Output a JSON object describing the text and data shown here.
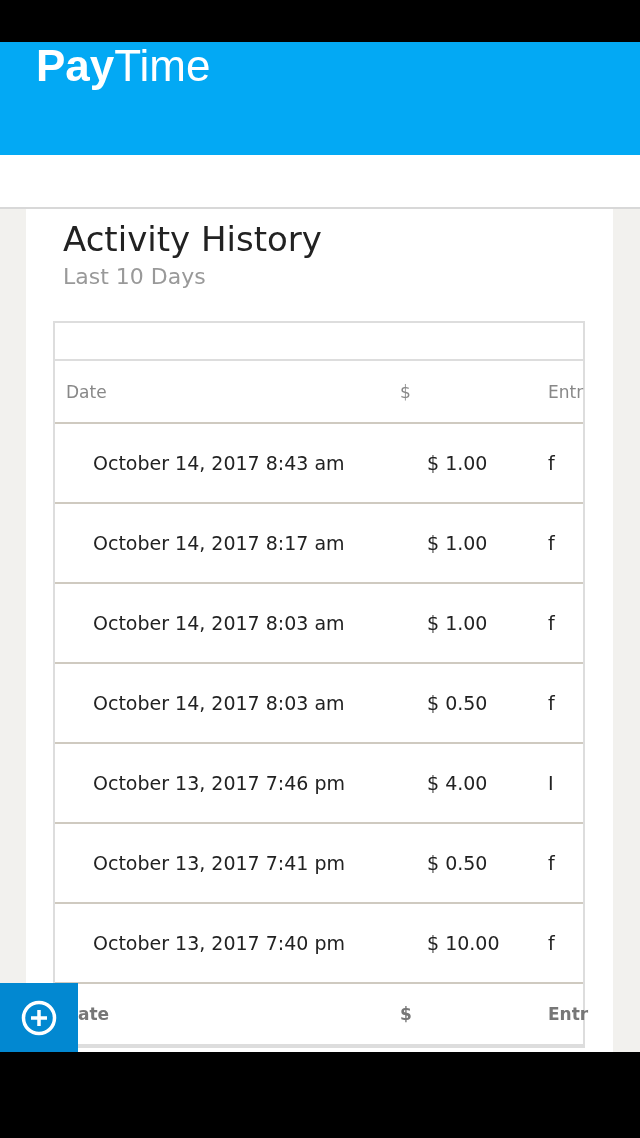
{
  "brand": {
    "bold": "Pay",
    "light": "Time"
  },
  "card": {
    "title": "Activity History",
    "subtitle": "Last 10 Days"
  },
  "table": {
    "columns": [
      "Date",
      "$",
      "Entr"
    ],
    "rows": [
      {
        "date": "October 14, 2017 8:43 am",
        "amount": "$ 1.00",
        "entry": "f"
      },
      {
        "date": "October 14, 2017 8:17 am",
        "amount": "$ 1.00",
        "entry": "f"
      },
      {
        "date": "October 14, 2017 8:03 am",
        "amount": "$ 1.00",
        "entry": "f"
      },
      {
        "date": "October 14, 2017 8:03 am",
        "amount": "$ 0.50",
        "entry": "f"
      },
      {
        "date": "October 13, 2017 7:46 pm",
        "amount": "$ 4.00",
        "entry": "I"
      },
      {
        "date": "October 13, 2017 7:41 pm",
        "amount": "$ 0.50",
        "entry": "f"
      },
      {
        "date": "October 13, 2017 7:40 pm",
        "amount": "$ 10.00",
        "entry": "f"
      }
    ],
    "footer_columns": [
      "ate",
      "$",
      "Entr"
    ]
  }
}
